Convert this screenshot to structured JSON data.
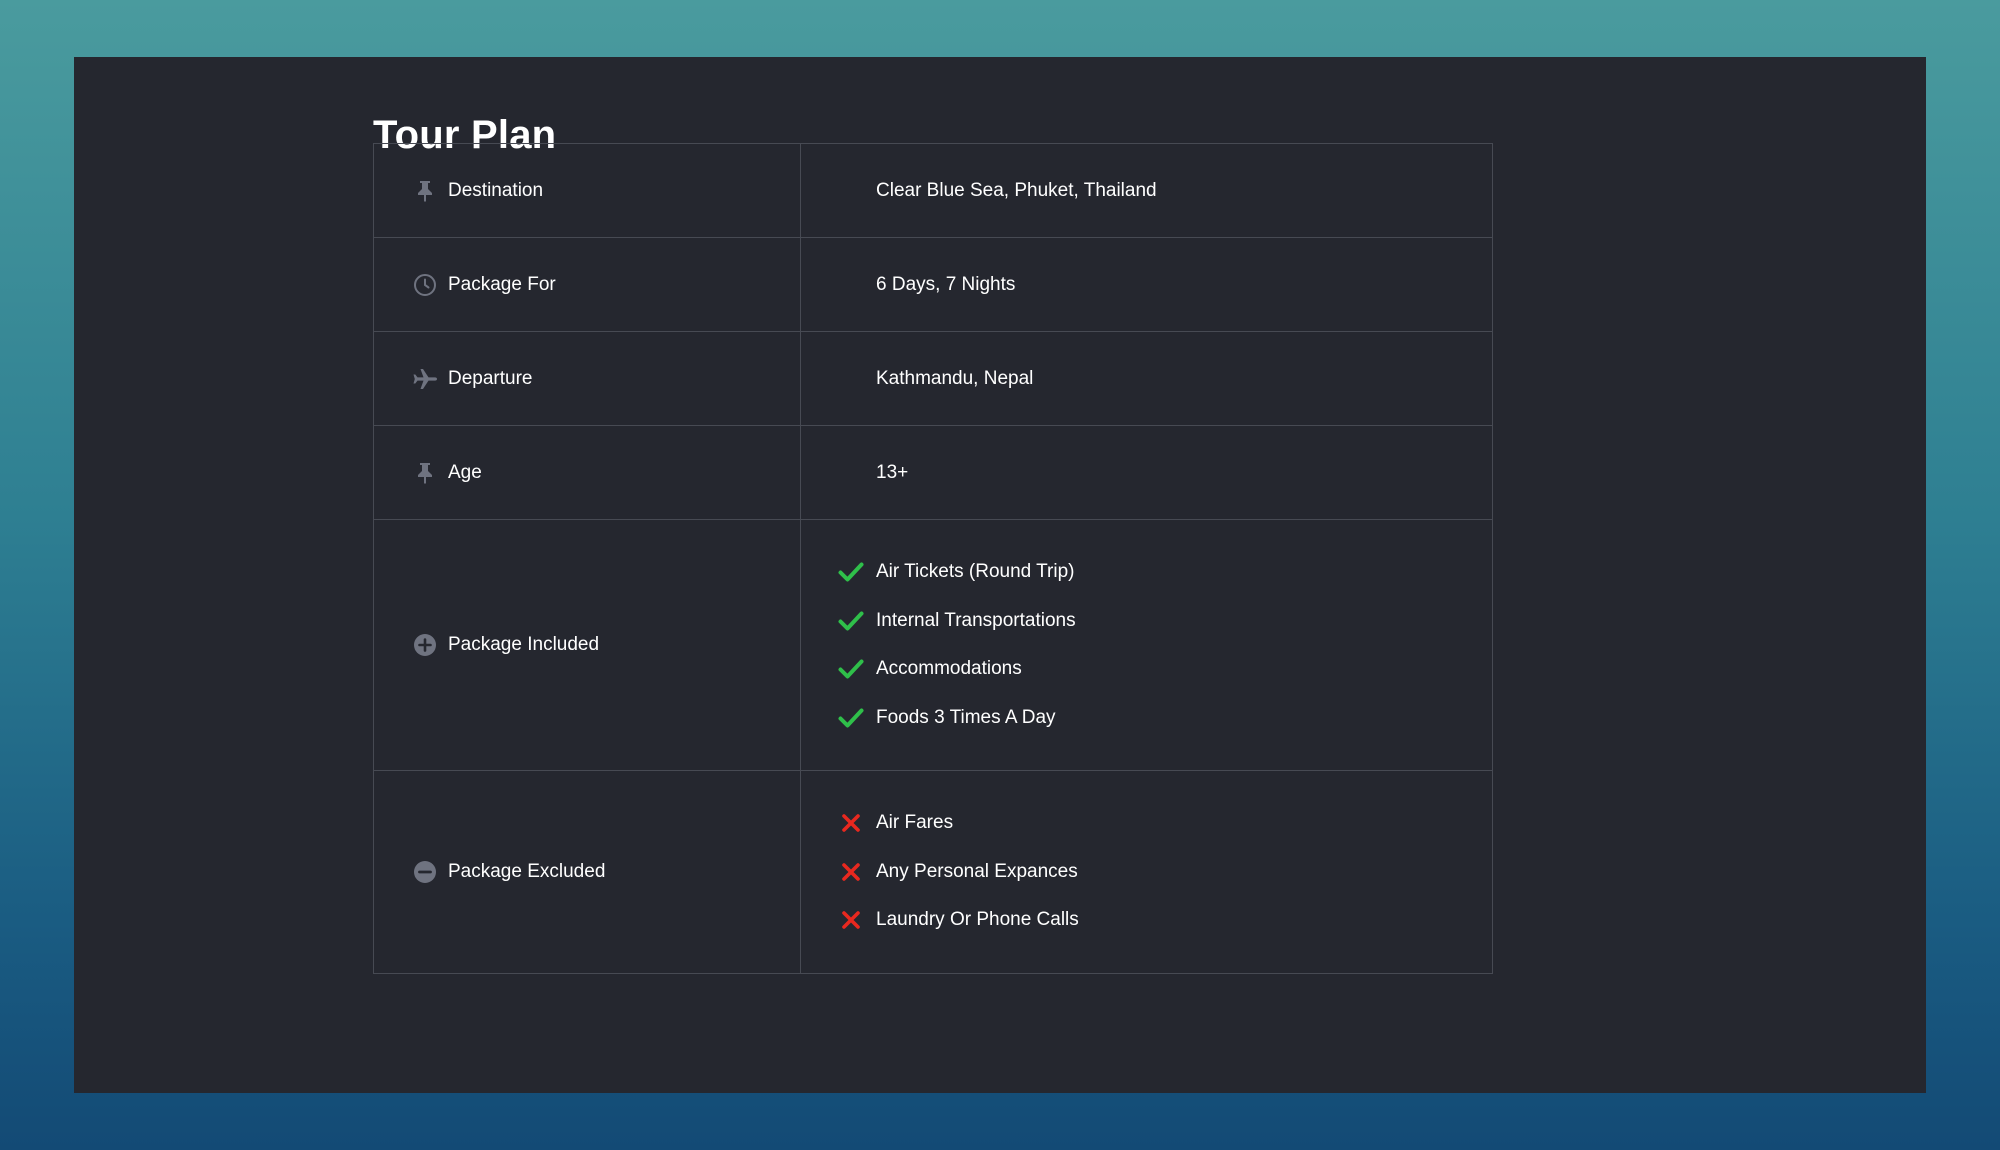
{
  "page": {
    "title": "Tour Plan"
  },
  "colors": {
    "background_gradient_top": "#4a9b9e",
    "background_gradient_bottom": "#134a75",
    "panel": "#25272f",
    "border": "#474a53",
    "text": "#ffffff",
    "icon": "#6f7380",
    "check": "#2fbf4a",
    "cross": "#e8281f"
  },
  "rows": [
    {
      "label": "Destination",
      "icon": "pin-icon",
      "value": "Clear Blue Sea, Phuket, Thailand"
    },
    {
      "label": "Package For",
      "icon": "clock-icon",
      "value": "6 Days, 7 Nights"
    },
    {
      "label": "Departure",
      "icon": "plane-icon",
      "value": "Kathmandu, Nepal"
    },
    {
      "label": "Age",
      "icon": "pin-icon",
      "value": "13+"
    }
  ],
  "included": {
    "label": "Package Included",
    "icon": "plus-circle-icon",
    "item_icon": "check-icon",
    "items": [
      "Air Tickets (Round Trip)",
      "Internal Transportations",
      "Accommodations",
      "Foods 3 Times A Day"
    ]
  },
  "excluded": {
    "label": "Package Excluded",
    "icon": "minus-circle-icon",
    "item_icon": "cross-icon",
    "items": [
      "Air Fares",
      "Any Personal Expances",
      "Laundry Or Phone Calls"
    ]
  }
}
